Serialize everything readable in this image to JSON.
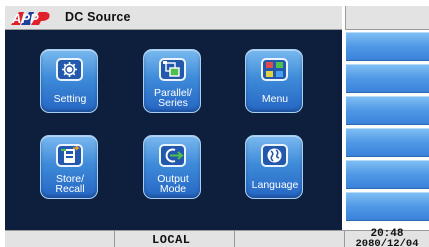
{
  "header": {
    "brand": "APP",
    "title": "DC Source"
  },
  "tiles": [
    {
      "label": "Setting",
      "icon": "gear-icon"
    },
    {
      "label": "Parallel/\nSeries",
      "icon": "parallel-series-icon"
    },
    {
      "label": "Menu",
      "icon": "menu-grid-icon"
    },
    {
      "label": "Store/\nRecall",
      "icon": "store-recall-icon"
    },
    {
      "label": "Output\nMode",
      "icon": "output-mode-icon"
    },
    {
      "label": "Language",
      "icon": "globe-icon"
    }
  ],
  "status": {
    "mode": "LOCAL",
    "time": "20:48",
    "date": "2080/12/04"
  },
  "colors": {
    "panel_bg": "#0d1f3d",
    "tile_blue": "#3f8bd9",
    "side_button_blue": "#4f98e6",
    "bar_gray": "#e3e3e3",
    "logo_red": "#e0202a"
  }
}
